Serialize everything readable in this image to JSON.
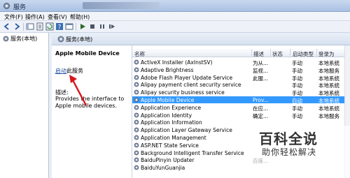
{
  "window": {
    "title": "服务"
  },
  "menu": [
    "文件(F)",
    "操作(A)",
    "查看(V)",
    "帮助(H)"
  ],
  "tree": {
    "root_label": "服务(本地)"
  },
  "panel": {
    "header": "服务(本地)"
  },
  "detail": {
    "service_name": "Apple Mobile Device",
    "start_link": "启动",
    "start_suffix": "此服务",
    "desc_label": "描述:",
    "desc_text": "Provides the interface to Apple mobile devices."
  },
  "table": {
    "columns": [
      "名称",
      "描述",
      "状态",
      "启动类型",
      "登录为"
    ],
    "rows": [
      {
        "name": "ActiveX Installer (AxInstSV)",
        "desc": "为从...",
        "status": "",
        "start": "手动",
        "logon": "本地系统"
      },
      {
        "name": "Adaptive Brightness",
        "desc": "监视...",
        "status": "",
        "start": "手动",
        "logon": "本地服务"
      },
      {
        "name": "Adobe Flash Player Update Service",
        "desc": "此服...",
        "status": "",
        "start": "手动",
        "logon": "本地系统"
      },
      {
        "name": "Alipay payment client security service",
        "desc": "",
        "status": "",
        "start": "手动",
        "logon": "本地系统"
      },
      {
        "name": "Alipay security business service",
        "desc": "",
        "status": "",
        "start": "手动",
        "logon": "本地系统"
      },
      {
        "name": "Apple Mobile Device",
        "desc": "Prov...",
        "status": "",
        "start": "自动",
        "logon": "本地系统",
        "selected": true
      },
      {
        "name": "Application Experience",
        "desc": "在应...",
        "status": "",
        "start": "手动",
        "logon": "本地系统"
      },
      {
        "name": "Application Identity",
        "desc": "确定...",
        "status": "",
        "start": "手动",
        "logon": "本地服务"
      },
      {
        "name": "Application Information",
        "desc": "",
        "status": "",
        "start": "",
        "logon": ""
      },
      {
        "name": "Application Layer Gateway Service",
        "desc": "",
        "status": "",
        "start": "",
        "logon": ""
      },
      {
        "name": "Application Management",
        "desc": "",
        "status": "",
        "start": "",
        "logon": ""
      },
      {
        "name": "ASP.NET State Service",
        "desc": "",
        "status": "",
        "start": "",
        "logon": ""
      },
      {
        "name": "Background Intelligent Transfer Service",
        "desc": "",
        "status": "",
        "start": "",
        "logon": ""
      },
      {
        "name": "BaiduPinyin Updater",
        "desc": "百度...",
        "status": "",
        "start": "",
        "logon": ""
      },
      {
        "name": "BaiduYunGuanjia",
        "desc": "",
        "status": "",
        "start": "",
        "logon": ""
      }
    ]
  },
  "watermark": {
    "title": "百科全说",
    "subtitle": "助你轻松解决"
  },
  "colors": {
    "selection": "#3399ff",
    "link": "#1e50a2",
    "arrow": "#d8151b"
  }
}
